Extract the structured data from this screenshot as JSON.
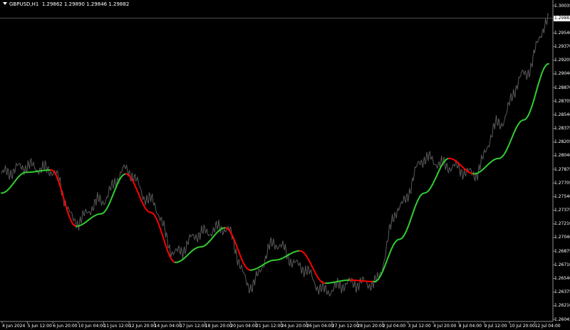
{
  "header": {
    "symbol": "GBPUSD,H1",
    "ohlc": "1.29862 1.29890 1.29846 1.29882"
  },
  "current_price_label": "1.29882",
  "price_axis": {
    "labels": [
      "1.30035",
      "1.29865",
      "1.29540",
      "1.29370",
      "1.29205",
      "1.29040",
      "1.28870",
      "1.28705",
      "1.28540",
      "1.28375",
      "1.28205",
      "1.28040",
      "1.27875",
      "1.27705",
      "1.27540",
      "1.27375",
      "1.27210",
      "1.27040",
      "1.26875",
      "1.26710",
      "1.26540",
      "1.26375",
      "1.26210",
      "1.26045"
    ]
  },
  "time_axis": {
    "labels": [
      "4 Jun 2024",
      "5 Jun 12:00",
      "6 Jun 20:00",
      "10 Jun 04:00",
      "11 Jun 12:00",
      "12 Jun 20:00",
      "14 Jun 04:00",
      "17 Jun 12:00",
      "18 Jun 20:00",
      "20 Jun 04:00",
      "21 Jun 12:00",
      "24 Jun 20:00",
      "26 Jun 04:00",
      "27 Jun 12:00",
      "28 Jun 20:00",
      "2 Jul 04:00",
      "3 Jul 12:00",
      "4 Jul 20:00",
      "8 Jul 04:00",
      "9 Jul 12:00",
      "10 Jul 20:00",
      "12 Jul 04:00"
    ]
  },
  "colors": {
    "background": "#000000",
    "price_line": "#5a5a5a",
    "ma_up": "#32cd32",
    "ma_down": "#ff0000",
    "axis_text": "#ffffff"
  },
  "chart_data": {
    "type": "line",
    "title": "GBPUSD,H1",
    "ylim": [
      1.2602,
      1.3012
    ],
    "x": [
      "4 Jun 2024",
      "5 Jun 12:00",
      "6 Jun 20:00",
      "10 Jun 04:00",
      "11 Jun 12:00",
      "12 Jun 20:00",
      "14 Jun 04:00",
      "17 Jun 12:00",
      "18 Jun 20:00",
      "20 Jun 04:00",
      "21 Jun 12:00",
      "24 Jun 20:00",
      "26 Jun 04:00",
      "27 Jun 12:00",
      "28 Jun 20:00",
      "2 Jul 04:00",
      "3 Jul 12:00",
      "4 Jul 20:00",
      "8 Jul 04:00",
      "9 Jul 12:00",
      "10 Jul 20:00",
      "12 Jul 04:00",
      "12 Jul 20:00"
    ],
    "series": [
      {
        "values": [
          1.279,
          1.28,
          1.2795,
          1.2728,
          1.2755,
          1.2795,
          1.2755,
          1.2687,
          1.2713,
          1.272,
          1.2645,
          1.27,
          1.267,
          1.2638,
          1.2648,
          1.2648,
          1.2747,
          1.281,
          1.28,
          1.279,
          1.2855,
          1.2918,
          1.2988
        ]
      },
      {
        "values": [
          1.2765,
          1.2792,
          1.2795,
          1.2722,
          1.2738,
          1.279,
          1.274,
          1.2675,
          1.2695,
          1.272,
          1.2665,
          1.2678,
          1.269,
          1.2648,
          1.2652,
          1.265,
          1.2705,
          1.2765,
          1.281,
          1.279,
          1.281,
          1.286,
          1.2933
        ]
      }
    ]
  }
}
